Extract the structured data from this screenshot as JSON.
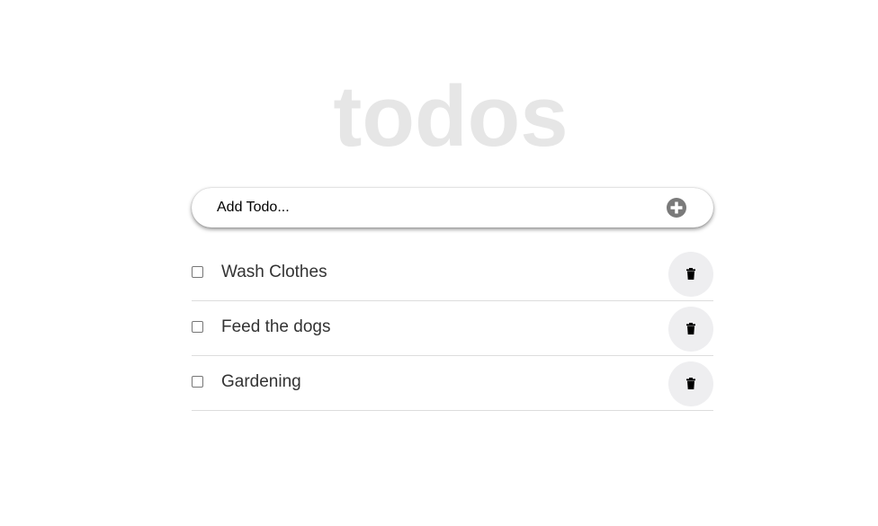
{
  "app": {
    "title": "todos"
  },
  "add_todo": {
    "placeholder": "Add Todo...",
    "value": "",
    "button_icon": "plus-circle-icon"
  },
  "todos": [
    {
      "label": "Wash Clothes",
      "done": false,
      "delete_icon": "trash-icon"
    },
    {
      "label": "Feed the dogs",
      "done": false,
      "delete_icon": "trash-icon"
    },
    {
      "label": "Gardening",
      "done": false,
      "delete_icon": "trash-icon"
    }
  ],
  "colors": {
    "title": "#e6e6e6",
    "text": "#333333",
    "add_icon": "#7a7a7a",
    "delete_bg": "#eeeef0",
    "divider": "#dddddd"
  }
}
